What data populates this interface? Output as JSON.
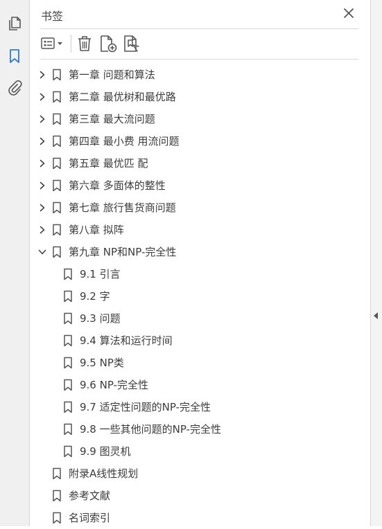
{
  "panel": {
    "title": "书签"
  },
  "icons": {
    "rail": [
      "pages-icon",
      "bookmark-icon",
      "attachment-icon"
    ],
    "toolbar": [
      "options-menu-icon",
      "delete-bookmark-icon",
      "new-bookmark-icon",
      "bookmark-from-selection-icon"
    ],
    "close": "close-icon"
  },
  "bookmarks": [
    {
      "label": "第一章 问题和算法",
      "level": 0,
      "expandable": true,
      "expanded": false
    },
    {
      "label": "第二章 最优树和最优路",
      "level": 0,
      "expandable": true,
      "expanded": false
    },
    {
      "label": "第三章 最大流问题",
      "level": 0,
      "expandable": true,
      "expanded": false
    },
    {
      "label": "第四章 最小费 用流问题",
      "level": 0,
      "expandable": true,
      "expanded": false
    },
    {
      "label": "第五章 最优匹 配",
      "level": 0,
      "expandable": true,
      "expanded": false
    },
    {
      "label": "第六章 多面体的整性",
      "level": 0,
      "expandable": true,
      "expanded": false
    },
    {
      "label": "第七章 旅行售货商问题",
      "level": 0,
      "expandable": true,
      "expanded": false
    },
    {
      "label": "第八章 拟阵",
      "level": 0,
      "expandable": true,
      "expanded": false
    },
    {
      "label": "第九章 NP和NP-完全性",
      "level": 0,
      "expandable": true,
      "expanded": true
    },
    {
      "label": "9.1 引言",
      "level": 1,
      "expandable": false,
      "expanded": false
    },
    {
      "label": "9.2 字",
      "level": 1,
      "expandable": false,
      "expanded": false
    },
    {
      "label": "9.3 问题",
      "level": 1,
      "expandable": false,
      "expanded": false
    },
    {
      "label": "9.4 算法和运行时间",
      "level": 1,
      "expandable": false,
      "expanded": false
    },
    {
      "label": "9.5 NP类",
      "level": 1,
      "expandable": false,
      "expanded": false
    },
    {
      "label": "9.6 NP-完全性",
      "level": 1,
      "expandable": false,
      "expanded": false
    },
    {
      "label": "9.7 适定性问题的NP-完全性",
      "level": 1,
      "expandable": false,
      "expanded": false
    },
    {
      "label": "9.8 一些其他问题的NP-完全性",
      "level": 1,
      "expandable": false,
      "expanded": false
    },
    {
      "label": "9.9 图灵机",
      "level": 1,
      "expandable": false,
      "expanded": false
    },
    {
      "label": "附录A线性规划",
      "level": 0,
      "expandable": false,
      "expanded": false
    },
    {
      "label": "参考文献",
      "level": 0,
      "expandable": false,
      "expanded": false
    },
    {
      "label": "名词索引",
      "level": 0,
      "expandable": false,
      "expanded": false
    }
  ],
  "colors": {
    "accent": "#2b7bd6",
    "icon": "#555555"
  }
}
